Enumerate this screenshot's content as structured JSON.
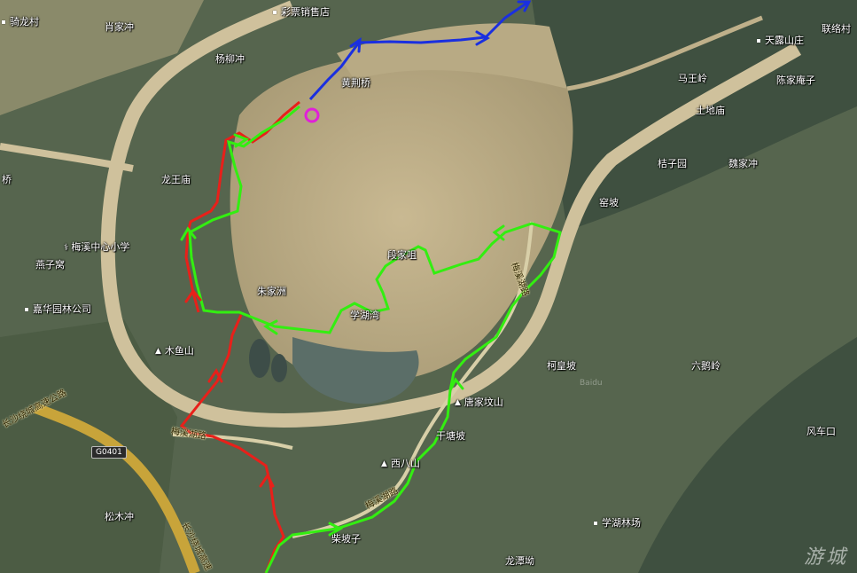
{
  "map": {
    "labels": [
      {
        "id": "qilongcun",
        "text": "骑龙村",
        "kind": "point"
      },
      {
        "id": "xiaojiachong",
        "text": "肖家冲",
        "kind": "plain"
      },
      {
        "id": "caipiao",
        "text": "彩票销售店",
        "kind": "point"
      },
      {
        "id": "yangliuchong",
        "text": "杨柳冲",
        "kind": "plain"
      },
      {
        "id": "jingjingqiao",
        "text": "黄荆桥",
        "kind": "plain"
      },
      {
        "id": "tianlushan",
        "text": "天露山庄",
        "kind": "point"
      },
      {
        "id": "lianjingcun",
        "text": "联络村",
        "kind": "plain"
      },
      {
        "id": "mawangling",
        "text": "马王岭",
        "kind": "plain"
      },
      {
        "id": "chenjiayanzi",
        "text": "陈家庵子",
        "kind": "plain"
      },
      {
        "id": "tudian",
        "text": "土地庙",
        "kind": "plain"
      },
      {
        "id": "luoziyuan",
        "text": "桔子园",
        "kind": "plain"
      },
      {
        "id": "weijiachong",
        "text": "魏家冲",
        "kind": "plain"
      },
      {
        "id": "yaopo",
        "text": "窑坡",
        "kind": "plain"
      },
      {
        "id": "longwangmiao",
        "text": "龙王庙",
        "kind": "plain"
      },
      {
        "id": "qiao",
        "text": "桥",
        "kind": "plain"
      },
      {
        "id": "meixi_school",
        "text": "梅溪中心小学",
        "kind": "school"
      },
      {
        "id": "yanzijie",
        "text": "燕子窝",
        "kind": "plain"
      },
      {
        "id": "jiahua",
        "text": "嘉华园林公司",
        "kind": "point"
      },
      {
        "id": "zhujiazhou",
        "text": "朱家洲",
        "kind": "plain"
      },
      {
        "id": "duanjiazui",
        "text": "段家咀",
        "kind": "plain"
      },
      {
        "id": "xuehuwan",
        "text": "学湖湾",
        "kind": "plain"
      },
      {
        "id": "muyushan",
        "text": "木鱼山",
        "kind": "mountain"
      },
      {
        "id": "tangjiafenshan",
        "text": "唐家坟山",
        "kind": "mountain"
      },
      {
        "id": "kehuangpo",
        "text": "柯皇坡",
        "kind": "plain"
      },
      {
        "id": "liuehling",
        "text": "六鹅岭",
        "kind": "plain"
      },
      {
        "id": "gantangpo",
        "text": "干塘坡",
        "kind": "plain"
      },
      {
        "id": "xibashan",
        "text": "西八山",
        "kind": "mountain"
      },
      {
        "id": "fengchekou",
        "text": "风车口",
        "kind": "plain"
      },
      {
        "id": "songmuchong",
        "text": "松木冲",
        "kind": "plain"
      },
      {
        "id": "chaipozi",
        "text": "柴坡子",
        "kind": "plain"
      },
      {
        "id": "xuehulinchang",
        "text": "学湖林场",
        "kind": "point"
      },
      {
        "id": "longtanao",
        "text": "龙潭坳",
        "kind": "plain"
      }
    ],
    "roads": {
      "meixihu_road_1": "梅溪湖路",
      "meixihu_road_2": "梅溪湖路",
      "meixihu_road_3": "梅溪湖路",
      "expressway": "长沙绕城高速公路",
      "expressway_2": "长沙绕城高速",
      "shield": "G0401"
    },
    "watermark": "游城",
    "watermark_small": "Baidu",
    "colors": {
      "red": "#e8201a",
      "green": "#33ee11",
      "blue": "#1a2fe0",
      "circle": "#e020d8",
      "expressway": "#c8a43a"
    }
  }
}
